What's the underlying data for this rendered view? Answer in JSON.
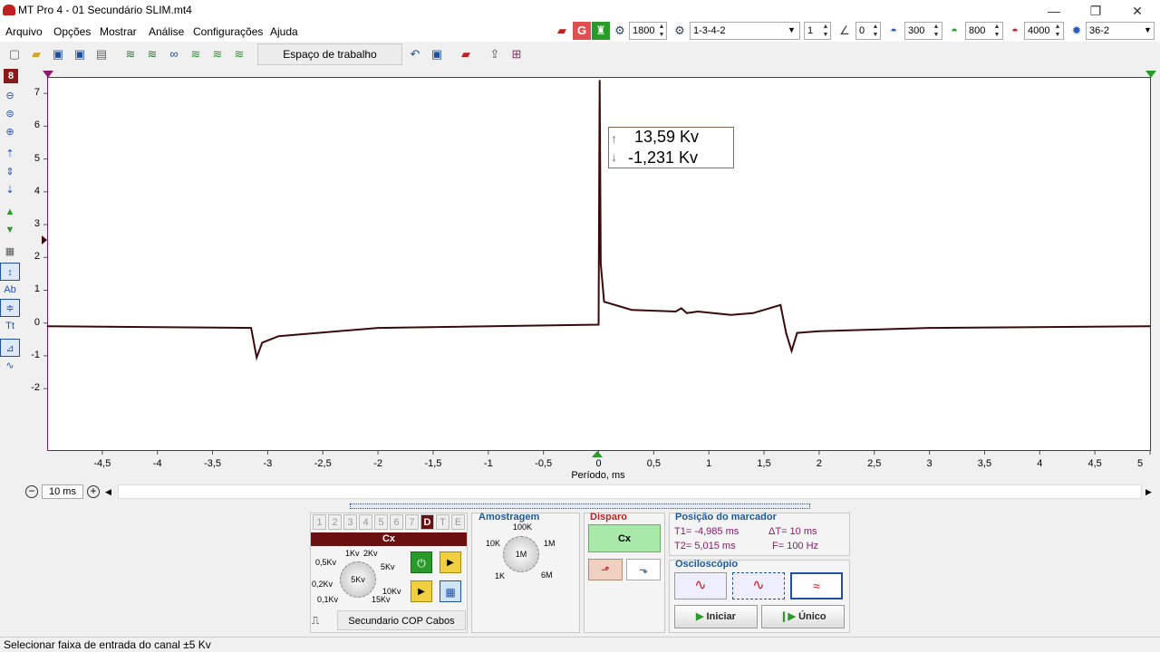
{
  "window": {
    "title": "MT Pro 4 - 01 Secundário SLIM.mt4",
    "minimize": "—",
    "restore": "❐",
    "close": "✕"
  },
  "menu": [
    "Arquivo",
    "Opções",
    "Mostrar",
    "Análise",
    "Configurações",
    "Ajuda"
  ],
  "toolbar": {
    "workspace": "Espaço de trabalho",
    "rpm": "1800",
    "firing_order": "1-3-4-2",
    "cylinder": "1",
    "angle": "0",
    "v1": "300",
    "v2": "800",
    "v3": "4000",
    "wheel": "36-2"
  },
  "left_tools": {
    "channel_badge": "8"
  },
  "plot": {
    "y_ticks": [
      "7",
      "6",
      "5",
      "4",
      "3",
      "2",
      "1",
      "0",
      "-1",
      "-2"
    ],
    "x_ticks": [
      "-4,5",
      "-4",
      "-3,5",
      "-3",
      "-2,5",
      "-2",
      "-1,5",
      "-1",
      "-0,5",
      "0",
      "0,5",
      "1",
      "1,5",
      "2",
      "2,5",
      "3",
      "3,5",
      "4",
      "4,5",
      "5"
    ],
    "xlabel": "Período, ms",
    "marker_max": "13,59 Kv",
    "marker_min": "-1,231 Kv"
  },
  "chart_data": {
    "type": "line",
    "xlabel": "Período, ms",
    "ylabel": "",
    "xlim": [
      -5,
      5
    ],
    "ylim": [
      -3.9,
      7.5
    ],
    "grid": false,
    "series": [
      {
        "color": "#3a0a0a",
        "x": [
          -5,
          -3.15,
          -3.1,
          -3.05,
          -2.9,
          -2,
          0,
          0.01,
          0.02,
          0.05,
          0.3,
          0.7,
          0.75,
          0.8,
          0.9,
          1.2,
          1.4,
          1.65,
          1.7,
          1.75,
          1.8,
          2,
          3,
          5
        ],
        "y": [
          -0.1,
          -0.15,
          -1.05,
          -0.6,
          -0.4,
          -0.15,
          -0.05,
          7.4,
          1.8,
          0.65,
          0.4,
          0.35,
          0.45,
          0.3,
          0.35,
          0.25,
          0.3,
          0.55,
          -0.3,
          -0.85,
          -0.3,
          -0.25,
          -0.15,
          -0.1
        ]
      }
    ]
  },
  "zoom": {
    "time": "10 ms"
  },
  "channel_panel": {
    "tabs": [
      "1",
      "2",
      "3",
      "4",
      "5",
      "6",
      "7",
      "D",
      "T",
      "E"
    ],
    "active": "D",
    "name": "Cx",
    "range_labels": [
      "1Kv",
      "2Kv",
      "0,5Kv",
      "5Kv",
      "0,2Kv",
      "5Kv",
      "10Kv",
      "0,1Kv",
      "15Kv"
    ],
    "knob": "5Kv",
    "probe": "Secundario COP Cabos"
  },
  "sampling": {
    "title": "Amostragem",
    "labels": [
      "100K",
      "10K",
      "1M",
      "1K",
      "6M"
    ],
    "knob": "1M"
  },
  "trigger": {
    "title": "Disparo",
    "source": "Cx"
  },
  "markers": {
    "title": "Posição do marcador",
    "t1": "T1= -4,985 ms",
    "t2": "T2= 5,015 ms",
    "dt": "ΔT= 10 ms",
    "f": "F= 100 Hz"
  },
  "scope": {
    "title": "Osciloscópio",
    "start": "Iniciar",
    "single": "Único"
  },
  "status": "Selecionar faixa de entrada do canal ±5 Kv"
}
